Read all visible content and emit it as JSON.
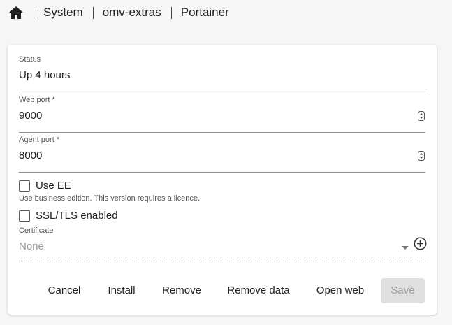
{
  "breadcrumb": {
    "home_icon": "home-icon",
    "items": [
      "System",
      "omv-extras",
      "Portainer"
    ]
  },
  "form": {
    "status": {
      "label": "Status",
      "value": "Up 4 hours"
    },
    "web_port": {
      "label": "Web port *",
      "value": "9000"
    },
    "agent_port": {
      "label": "Agent port *",
      "value": "8000"
    },
    "use_ee": {
      "label": "Use EE",
      "checked": false,
      "hint": "Use business edition. This version requires a licence."
    },
    "ssl": {
      "label": "SSL/TLS enabled",
      "checked": false
    },
    "certificate": {
      "label": "Certificate",
      "value": "None"
    }
  },
  "actions": {
    "cancel": "Cancel",
    "install": "Install",
    "remove": "Remove",
    "remove_data": "Remove data",
    "open_web": "Open web",
    "save": "Save"
  },
  "colors": {
    "background": "#f6f6f6",
    "card": "#ffffff",
    "disabled_button": "#e0e0e0",
    "disabled_text": "#9e9e9e"
  }
}
